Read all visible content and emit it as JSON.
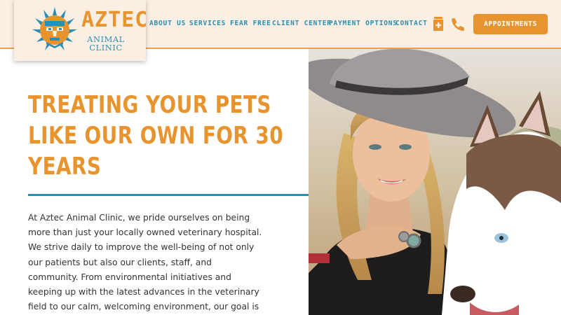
{
  "brand": {
    "name": "AZTEC",
    "subtitle_line1": "ANIMAL",
    "subtitle_line2": "CLINIC",
    "orange": "#e8942e",
    "blue": "#2a8fb2",
    "header_bg": "#fbeee2"
  },
  "nav": {
    "items": [
      {
        "label": "ABOUT US"
      },
      {
        "label": "SERVICES"
      },
      {
        "label": "FEAR FREE"
      },
      {
        "label": "CLIENT CENTER"
      },
      {
        "label": "PAYMENT OPTIONS"
      },
      {
        "label": "CONTACT"
      }
    ],
    "pharmacy_icon": "pharmacy-icon",
    "phone_icon": "phone-icon",
    "appointments_label": "APPOINTMENTS"
  },
  "hero": {
    "title_line1": "TREATING YOUR PETS",
    "title_line2": "LIKE OUR OWN FOR 30",
    "title_line3": "YEARS",
    "body_lines": [
      "At Aztec Animal Clinic, we pride ourselves on being",
      "more than just your locally owned veterinary hospital.",
      "We strive daily to improve the well-being of not only",
      "our patients but also our clients, staff, and",
      "community. From environmental initiatives and",
      "keeping up with the latest advances in the veterinary",
      "field to our calm, welcoming environment, our goal is"
    ],
    "photo": "woman-with-husky-photo"
  }
}
